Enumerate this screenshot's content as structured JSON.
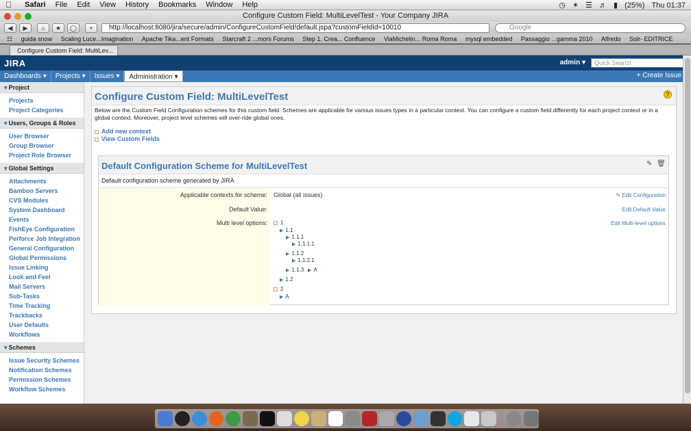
{
  "menubar": {
    "app": "Safari",
    "items": [
      "File",
      "Edit",
      "View",
      "History",
      "Bookmarks",
      "Window",
      "Help"
    ],
    "battery": "(25%)",
    "clock": "Thu 01:37"
  },
  "window": {
    "title": "Configure Custom Field: MultiLevelTest - Your Company JIRA"
  },
  "browser": {
    "url": "http://localhost:8080/jira/secure/admin/ConfigureCustomField!default.jspa?customFieldId=10010",
    "search_placeholder": "Google",
    "bookmarks": [
      "guida snow",
      "Scaling Luce...Imagination",
      "Apache Tika...ent Formats",
      "Starcraft 2 ...mors Forums",
      "Step 1. Crea... Confluence",
      "ViaMichelin... Roma Roma",
      "mysql embedded",
      "Passaggio ...gamma 2010",
      "Alfredo",
      "Solr- EDITRICE"
    ],
    "tab": "Configure Custom Field: MultiLev..."
  },
  "jira": {
    "logo": "JIRA",
    "user": "admin",
    "quicksearch_placeholder": "Quick Search",
    "nav": [
      "Dashboards",
      "Projects",
      "Issues",
      "Administration"
    ],
    "create_issue": "+ Create Issue"
  },
  "sidebar": {
    "sections": [
      {
        "title": "Project",
        "items": [
          "Projects",
          "Project Categories"
        ]
      },
      {
        "title": "Users, Groups & Roles",
        "items": [
          "User Browser",
          "Group Browser",
          "Project Role Browser"
        ]
      },
      {
        "title": "Global Settings",
        "items": [
          "Attachments",
          "Bamboo Servers",
          "CVS Modules",
          "System Dashboard",
          "Events",
          "FishEye Configuration",
          "Perforce Job Integration",
          "General Configuration",
          "Global Permissions",
          "Issue Linking",
          "Look and Feel",
          "Mail Servers",
          "Sub-Tasks",
          "Time Tracking",
          "Trackbacks",
          "User Defaults",
          "Workflows"
        ]
      },
      {
        "title": "Schemes",
        "items": [
          "Issue Security Schemes",
          "Notification Schemes",
          "Permission Schemes",
          "Workflow Schemes"
        ]
      }
    ]
  },
  "main": {
    "title": "Configure Custom Field: MultiLevelTest",
    "description": "Below are the Custom Field Configuration schemes for this custom field. Schemes are applicable for various issues types in a particular context. You can configure a custom field differently for each project context or in a global context. Moreover, project level schemes will over-ride global ones.",
    "links": [
      "Add new context",
      "View Custom Fields"
    ]
  },
  "scheme": {
    "title": "Default Configuration Scheme for MultiLevelTest",
    "description": "Default configuration scheme generated by JIRA",
    "rows": [
      {
        "label": "Applicable contexts for scheme:",
        "value": "Global (all issues)",
        "action": "Edit Configuration"
      },
      {
        "label": "Default Value:",
        "value": "",
        "action": "Edit Default Value"
      },
      {
        "label": "Multi level options:",
        "value": "",
        "action": "Edit Multi-level options"
      }
    ],
    "tree": [
      "1",
      "1.1",
      "1.1.1",
      "1.1.1.1",
      "1.1.2",
      "1.1.2.1",
      "1.1.3",
      "A",
      "1.2",
      "2",
      "A"
    ]
  }
}
